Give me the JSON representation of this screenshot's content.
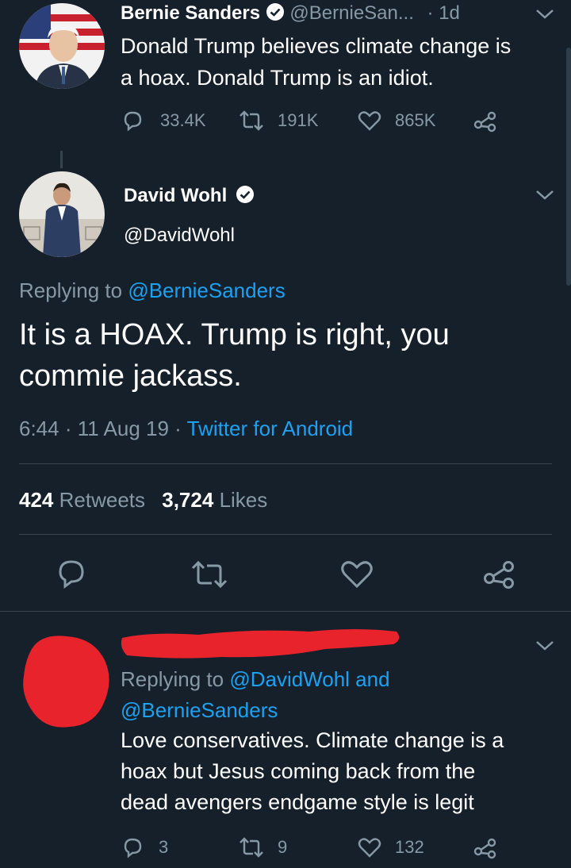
{
  "tweet1": {
    "author_name": "Bernie Sanders",
    "handle": "@BernieSan...",
    "time": "· 1d",
    "text_line1": "Donald Trump believes climate change is",
    "text_line2": "a hoax. Donald Trump is an idiot.",
    "replies": "33.4K",
    "retweets": "191K",
    "likes": "865K"
  },
  "main_tweet": {
    "author_name": "David Wohl",
    "handle": "@DavidWohl",
    "replying_prefix": "Replying to ",
    "replying_to": "@BernieSanders",
    "text_line1": "It is a HOAX. Trump is right, you",
    "text_line2": "commie jackass.",
    "time": "6:44",
    "date": "11 Aug 19",
    "sep": "·",
    "source": "Twitter for Android",
    "retweet_count": "424",
    "retweet_label": "Retweets",
    "like_count": "3,724",
    "like_label": "Likes"
  },
  "reply": {
    "replying_prefix": "Replying to ",
    "replying_to_1": "@DavidWohl",
    "and": " and",
    "replying_to_2": "@BernieSanders",
    "text_line1": "Love conservatives. Climate change is a",
    "text_line2": "hoax but Jesus coming back from the",
    "text_line3": "dead avengers endgame style is legit",
    "replies": "3",
    "retweets": "9",
    "likes": "132"
  },
  "colors": {
    "background": "#15202b",
    "muted": "#8899a6",
    "link": "#1da1f2",
    "redaction": "#e8232b"
  }
}
